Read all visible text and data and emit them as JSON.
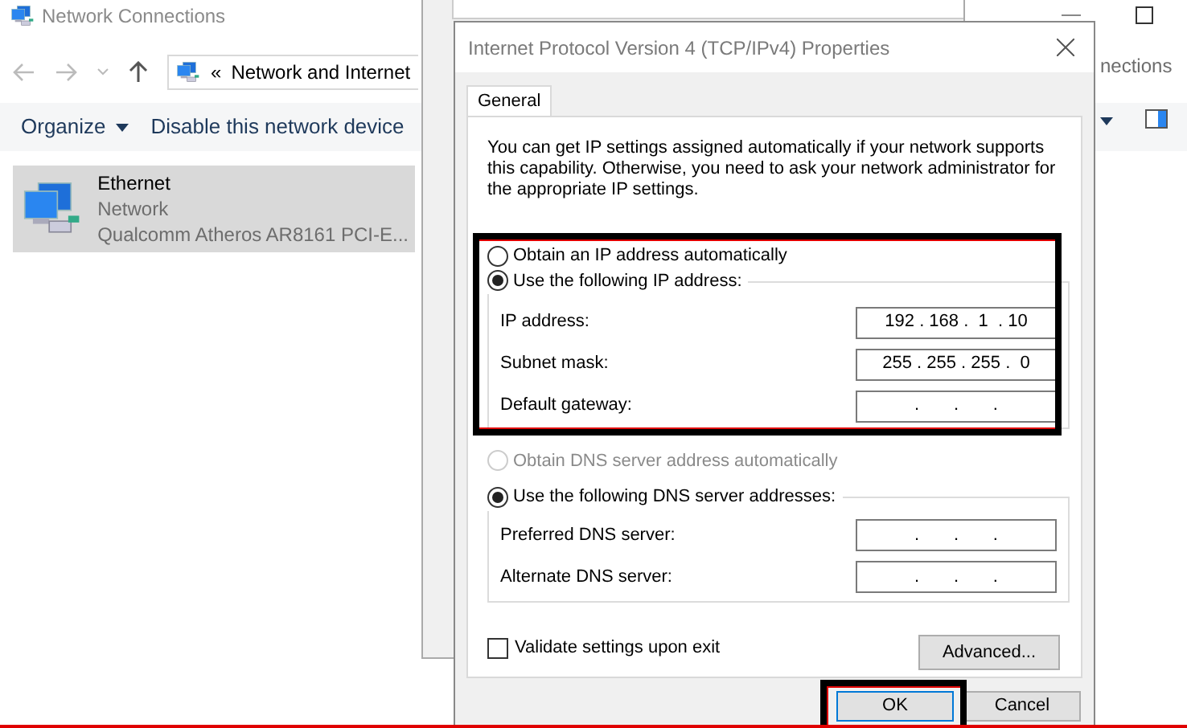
{
  "explorer": {
    "title": "Network Connections",
    "address": {
      "chevron": "«",
      "path": "Network and Internet"
    },
    "search": {
      "placeholder": "nections"
    },
    "toolbar": [
      "Organize",
      "Disable this network device"
    ],
    "items": [
      {
        "name": "Ethernet",
        "status": "Network",
        "device": "Qualcomm Atheros AR8161 PCI-E...",
        "selected": true
      }
    ]
  },
  "dialog": {
    "title": "Internet Protocol Version 4 (TCP/IPv4) Properties",
    "tabs": [
      {
        "label": "General",
        "selected": true
      }
    ],
    "description": "You can get IP settings assigned automatically if your network supports this capability. Otherwise, you need to ask your network administrator for the appropriate IP settings.",
    "ip_options": [
      {
        "label": "Obtain an IP address automatically",
        "selected": false,
        "disabled": false
      },
      {
        "label": "Use the following IP address:",
        "selected": true,
        "disabled": false
      }
    ],
    "ip_fields": [
      {
        "label": "IP address:",
        "value": "192 . 168 .  1  . 10"
      },
      {
        "label": "Subnet mask:",
        "value": "255 . 255 . 255 .  0"
      },
      {
        "label": "Default gateway:",
        "value": ".       .       ."
      }
    ],
    "dns_options": [
      {
        "label": "Obtain DNS server address automatically",
        "selected": false,
        "disabled": true
      },
      {
        "label": "Use the following DNS server addresses:",
        "selected": true,
        "disabled": false
      }
    ],
    "dns_fields": [
      {
        "label": "Preferred DNS server:",
        "value": ".       .       ."
      },
      {
        "label": "Alternate DNS server:",
        "value": ".       .       ."
      }
    ],
    "validate": {
      "label": "Validate settings upon exit",
      "checked": false
    },
    "advanced_button": "Advanced...",
    "buttons": [
      "OK",
      "Cancel"
    ]
  }
}
